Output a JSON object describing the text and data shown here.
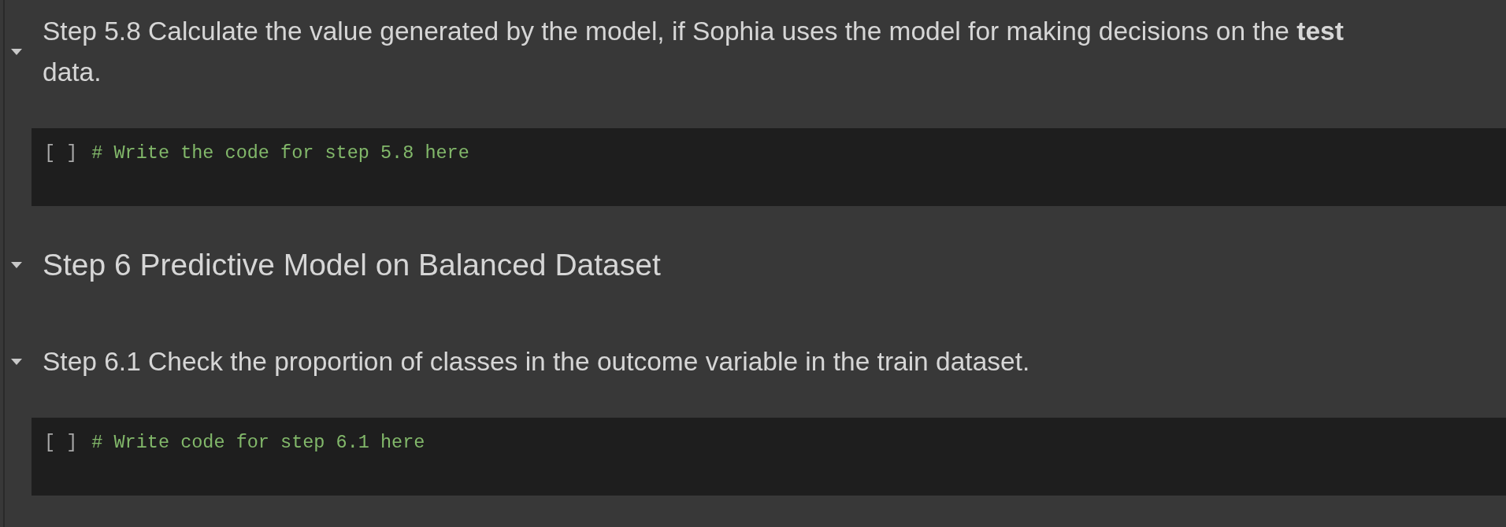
{
  "cells": [
    {
      "kind": "step",
      "expanded": true,
      "text": "Step 5.8 Calculate the value generated by the model, if Sophia uses the model for making decisions on the **test** data."
    },
    {
      "kind": "code",
      "prompt": "[ ]",
      "code": "# Write the code for step 5.8 here"
    },
    {
      "kind": "section",
      "expanded": true,
      "text": "Step 6 Predictive Model on Balanced Dataset"
    },
    {
      "kind": "step",
      "expanded": true,
      "text": "Step 6.1 Check the proportion of classes in the outcome variable in the train dataset."
    },
    {
      "kind": "code",
      "prompt": "[ ]",
      "code": "# Write code for step 6.1 here"
    }
  ]
}
